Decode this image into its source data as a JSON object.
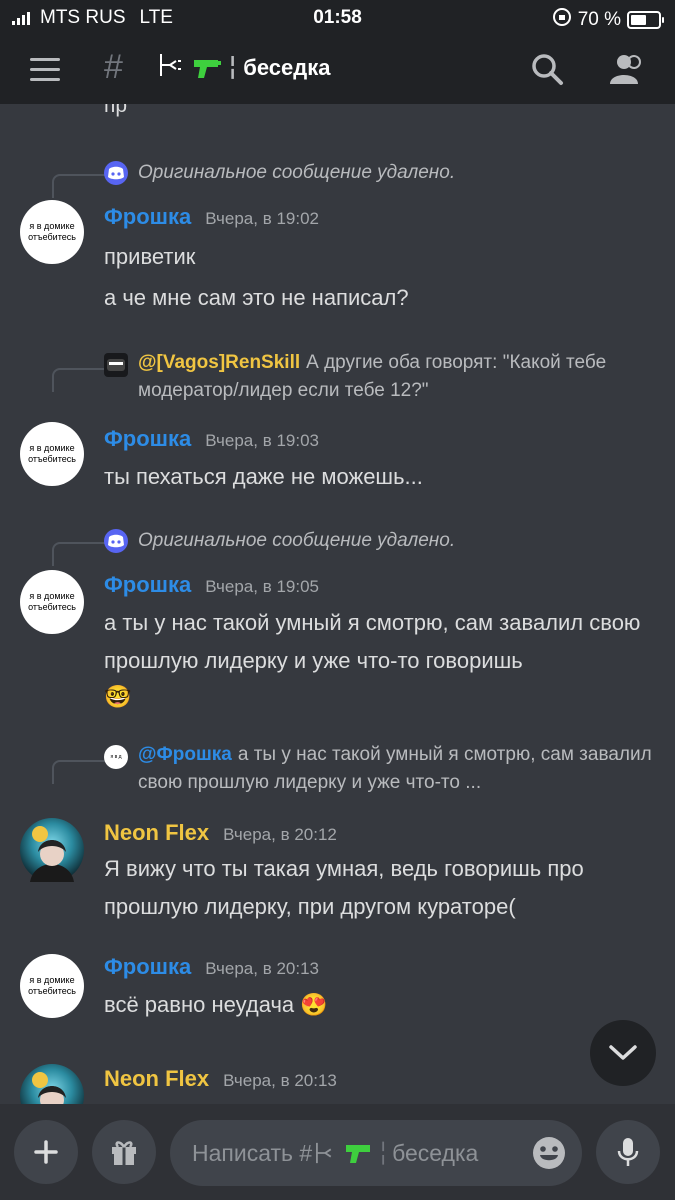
{
  "status_bar": {
    "carrier": "MTS RUS",
    "network": "LTE",
    "time": "01:58",
    "battery": "70 %",
    "battery_level": 0.7
  },
  "header": {
    "channel_prefix": "#",
    "channel_name": "беседка",
    "icons": [
      "menu-icon",
      "hash-icon",
      "search-icon",
      "members-icon"
    ]
  },
  "cut_top_text": "пр",
  "messages": [
    {
      "reply": {
        "kind": "deleted",
        "text": "Оригинальное сообщение удалено."
      },
      "author": "Фрошка",
      "author_color": "#2d8ce6",
      "timestamp": "Вчера, в 19:02",
      "avatar_text": "я в домике отъебитесь",
      "lines": [
        "приветик",
        "а че мне сам это не написал?"
      ]
    },
    {
      "reply": {
        "kind": "quote",
        "mention": "@[Vagos]RenSkill",
        "mention_color": "#f0c542",
        "text": "А другие оба говорят: \"Какой тебе модератор/лидер если тебе 12?\""
      },
      "author": "Фрошка",
      "author_color": "#2d8ce6",
      "timestamp": "Вчера, в 19:03",
      "avatar_text": "я в домике отъебитесь",
      "lines": [
        "ты пехаться даже не можешь..."
      ]
    },
    {
      "reply": {
        "kind": "deleted",
        "text": "Оригинальное сообщение удалено."
      },
      "author": "Фрошка",
      "author_color": "#2d8ce6",
      "timestamp": "Вчера, в 19:05",
      "avatar_text": "я в домике отъебитесь",
      "lines": [
        "а ты у нас такой умный я смотрю, сам завалил свою прошлую лидерку и уже что-то говоришь"
      ],
      "emoji": "🤓"
    },
    {
      "reply": {
        "kind": "quote",
        "mention": "@Фрошка",
        "mention_color": "#2d8ce6",
        "text": "а ты у нас такой умный я смотрю, сам завалил свою прошлую лидерку и уже что-то ..."
      },
      "author": "Neon Flex",
      "author_color": "#f0c542",
      "timestamp": "Вчера, в 20:12",
      "avatar_text": "",
      "lines": [
        "Я вижу что ты такая умная, ведь говоришь про прошлую лидерку, при другом кураторе("
      ]
    },
    {
      "author": "Фрошка",
      "author_color": "#2d8ce6",
      "timestamp": "Вчера, в 20:13",
      "avatar_text": "я в домике отъебитесь",
      "lines": [
        "всё равно неудача 😍"
      ]
    },
    {
      "author": "Neon Flex",
      "author_color": "#f0c542",
      "timestamp": "Вчера, в 20:13",
      "avatar_text": "",
      "lines": []
    }
  ],
  "composer": {
    "placeholder_prefix": "Написать #",
    "placeholder_channel": "беседка",
    "icons": [
      "plus-icon",
      "gift-icon",
      "emoji-icon",
      "microphone-icon"
    ]
  },
  "jump_button_icon": "chevron-down-icon"
}
